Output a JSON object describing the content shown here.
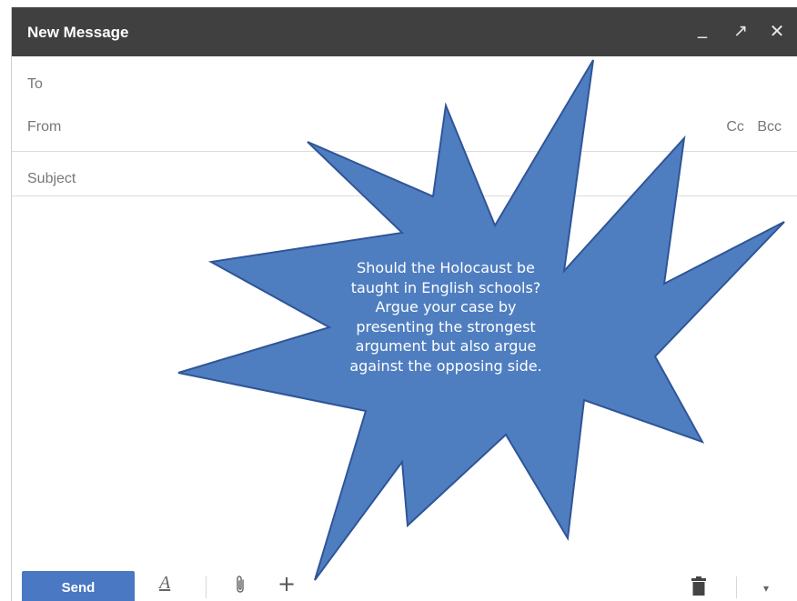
{
  "window": {
    "title": "New Message",
    "controls": {
      "minimize": "_",
      "popout": "↗",
      "close": "✕"
    }
  },
  "fields": {
    "to_label": "To",
    "from_label": "From",
    "cc_label": "Cc",
    "bcc_label": "Bcc",
    "subject_label": "Subject"
  },
  "toolbar": {
    "send_label": "Send",
    "format_label": "A",
    "attach_icon": "paperclip-icon",
    "plus_label": "+",
    "trash_icon": "trash-icon",
    "more_label": "▾"
  },
  "callout": {
    "lines": [
      "Should the Holocaust be",
      "taught in English schools?",
      "Argue your case by",
      "presenting the strongest",
      "argument but also argue",
      "against the opposing side."
    ],
    "fill": "#4f7ec0",
    "stroke": "#2f5597"
  },
  "colors": {
    "titlebar": "#404040",
    "send": "#4a78c2"
  }
}
